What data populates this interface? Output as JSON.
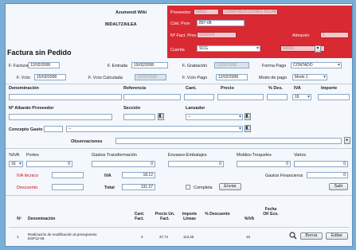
{
  "header": {
    "company_name": "Azumendi Wiki",
    "company_code": "BIDALTZAILEA",
    "red_labels": [
      "Proveedor",
      "Cód. Prov",
      "Nº Fact. Prov",
      "Almacén",
      "Cuenta"
    ],
    "proveedor_value": "00001",
    "proveedor_name": "CONSTRUCCIONES ZULAIKA",
    "cod_prov_value": "897-08",
    "fact_prov_value": "0000000",
    "almacen_label": "Almacén",
    "almacen_value": "1",
    "cuenta_value": "SCG",
    "right_select_value": "00000"
  },
  "title": "Factura sin Pedido",
  "row1": {
    "f_factura_label": "F. Factura",
    "f_factura_value": "12/02/2008",
    "f_entrada_label": "F. Entrada",
    "f_entrada_value": "15/02/2008",
    "f_grabacion_label": "F. Grabación",
    "f_grabacion_value": "12/02/2008",
    "forma_pago_label": "Forma Pago",
    "forma_pago_value": "CONTADO"
  },
  "row2": {
    "f_vcto_label": "F. Vcto",
    "f_vcto_value": "15/03/2008",
    "f_vcto_calc_label": "F. Vcto Calculada",
    "f_vcto_calc_value": "12/02/2008",
    "f_vcto_pago_label": "F. Vcto Pago",
    "f_vcto_pago_value": "12/02/2008",
    "modo_pago_label": "Modo de pago",
    "modo_pago_value": "Modo 1"
  },
  "line_headers": {
    "denominacion": "Denominación",
    "referencia": "Referencia",
    "cant": "Cant.",
    "precio": "Precio",
    "pct_des": "% Des.",
    "iva": "IVA",
    "importe": "Importe",
    "iva_value": "16"
  },
  "albaran": {
    "albaran_label": "Nº Albarán Proveedor",
    "seccion_label": "Sección",
    "lanzador_label": "Lanzador",
    "lanzador_value": "--"
  },
  "concepto": {
    "label": "Concepto Gasto",
    "value": "--",
    "observaciones_label": "Observaciones"
  },
  "totals": {
    "iva_pct_label": "%IVA",
    "portes_label": "Portes",
    "iva_pct_value": "16",
    "portes_value": "0",
    "gastos_transf_label": "Gastos Transformación",
    "gastos_transf_value": "0",
    "envases_label": "Envases-Embalajes",
    "envases_value": "0",
    "moldes_label": "Moldes-Troqueles",
    "moldes_value": "0",
    "varios_label": "Varios",
    "varios_value": "0",
    "iva_tecnico_label": "IVA técnico",
    "descuento_label": "Descuento",
    "iva_label": "IVA",
    "iva_value": "18.12",
    "total_label": "Total",
    "total_value": "131.37",
    "completa_label": "Completa",
    "gastos_fin_label": "Gastos Financieros",
    "gastos_fin_value": "0",
    "enviar_label": "Enviar",
    "salir_label": "Salir"
  },
  "table": {
    "columns": [
      "Nº",
      "Denominación",
      "Cant. Fact.",
      "Precio Un. Fact.",
      "Importe Líneas",
      "% Descuento",
      "%IVA",
      "Fecha OK Eco."
    ],
    "rows": [
      {
        "n": "1",
        "denominacion": "Realización de modificación al presupuesto ESP12-06",
        "cant": "3",
        "precio": "37,71",
        "importe": "113,25",
        "descuento": "",
        "iva": "16",
        "fecha": "",
        "borrar_label": "Borrar",
        "editar_label": "Editar"
      }
    ]
  }
}
